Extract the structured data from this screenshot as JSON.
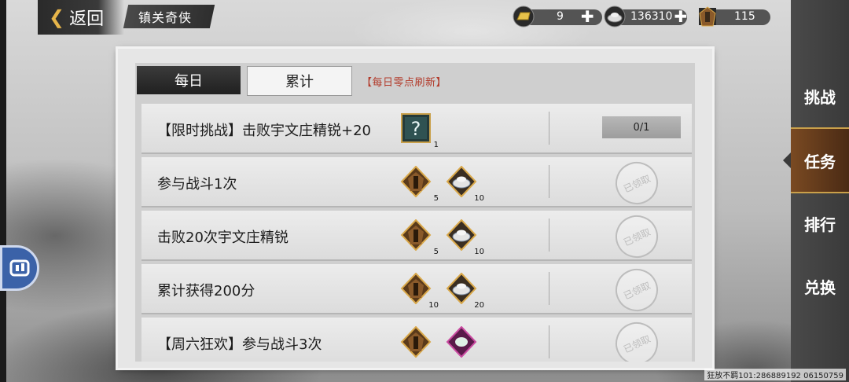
{
  "topbar": {
    "back_label": "返回",
    "title": "镇关奇侠",
    "gold": "9",
    "silver": "136310",
    "token": "115"
  },
  "tabs": {
    "daily": "每日",
    "cumulative": "累计",
    "refresh_note": "【每日零点刷新】"
  },
  "tasks": [
    {
      "label": "【限时挑战】击败宇文庄精锐+20",
      "rewards": [
        {
          "icon": "mystery-box-icon",
          "count": "1"
        }
      ],
      "status": "0/1"
    },
    {
      "label": "参与战斗1次",
      "rewards": [
        {
          "icon": "token-icon",
          "count": "5"
        },
        {
          "icon": "silver-ingot-icon",
          "count": "10"
        }
      ],
      "status": "已领取"
    },
    {
      "label": "击败20次宇文庄精锐",
      "rewards": [
        {
          "icon": "token-icon",
          "count": "5"
        },
        {
          "icon": "silver-ingot-icon",
          "count": "10"
        }
      ],
      "status": "已领取"
    },
    {
      "label": "累计获得200分",
      "rewards": [
        {
          "icon": "token-icon",
          "count": "10"
        },
        {
          "icon": "silver-ingot-icon",
          "count": "20"
        }
      ],
      "status": "已领取"
    },
    {
      "label": "【周六狂欢】参与战斗3次",
      "rewards": [
        {
          "icon": "token-icon",
          "count": ""
        },
        {
          "icon": "purple-gem-icon",
          "count": ""
        }
      ],
      "status": "已领取"
    }
  ],
  "sidenav": {
    "challenge": "挑战",
    "tasks": "任务",
    "ranking": "排行",
    "exchange": "兑换"
  },
  "watermark": "狂放不羁101:286889192 06150759",
  "colors": {
    "accent": "#e7b54a",
    "refresh": "#b23a2a",
    "active_nav": "#7a4a22"
  }
}
